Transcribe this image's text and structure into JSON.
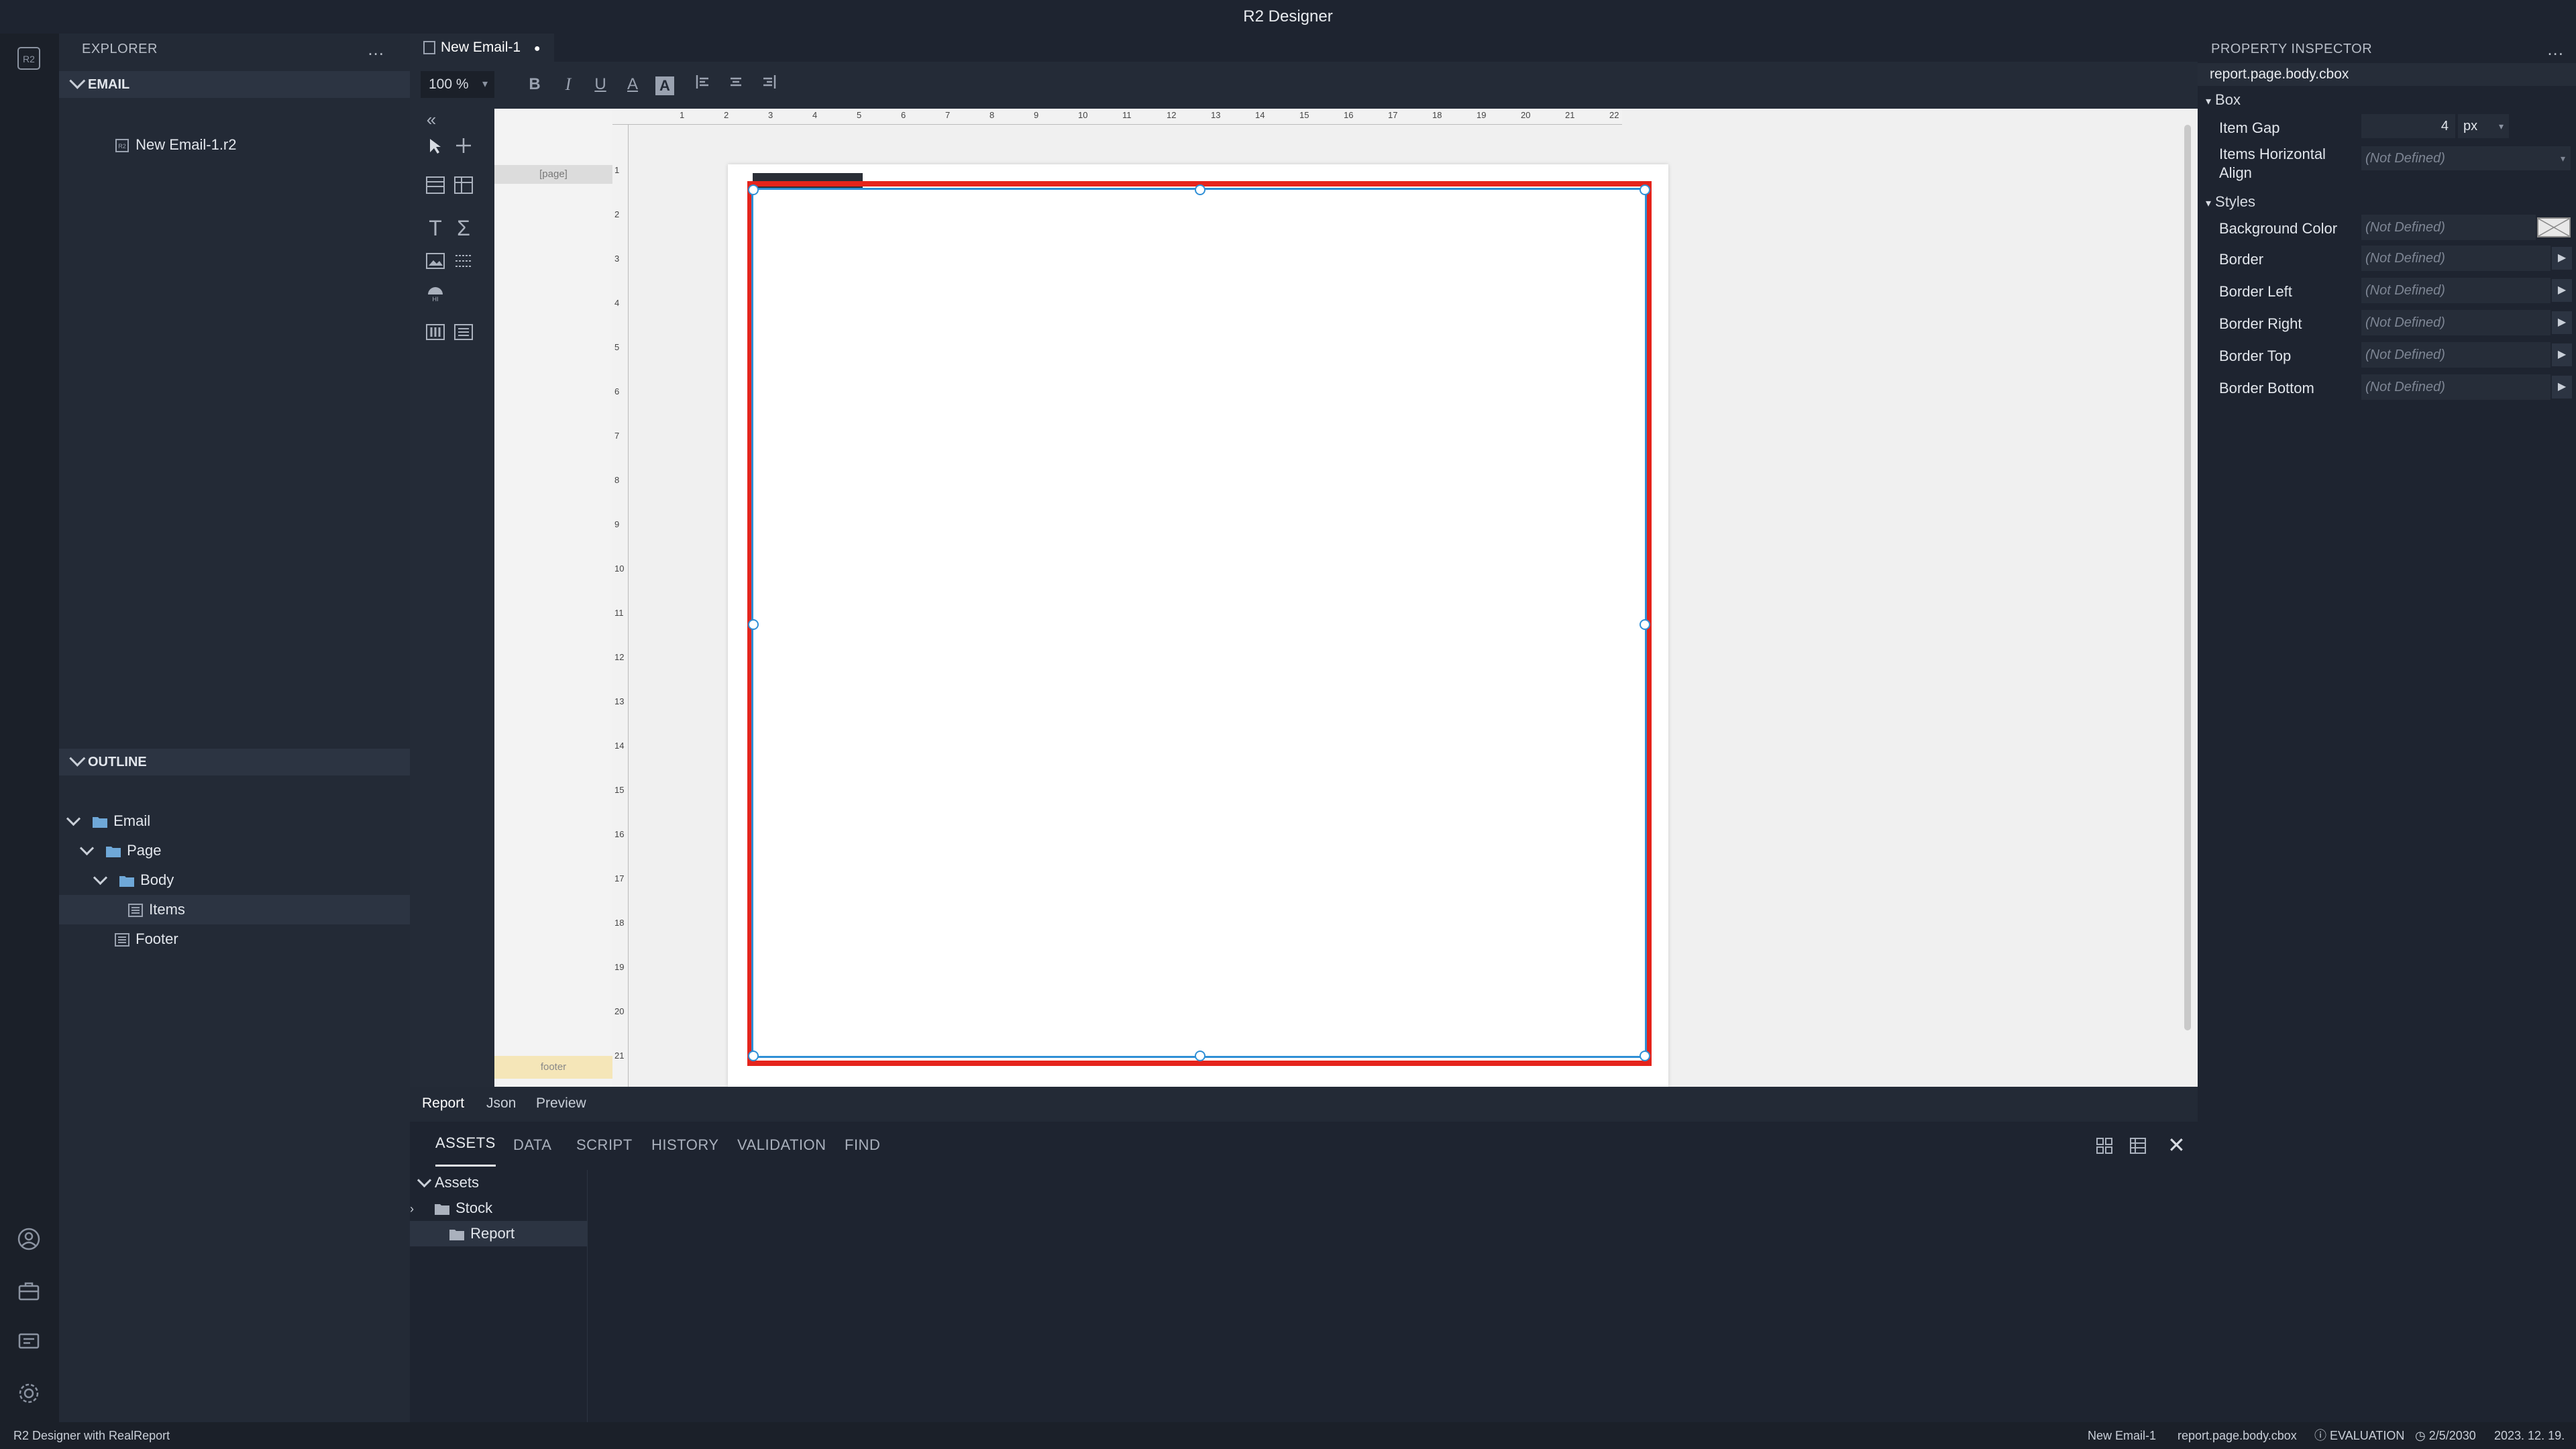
{
  "app": {
    "title": "R2 Designer"
  },
  "explorer": {
    "title": "EXPLORER",
    "menu": "...",
    "section": "EMAIL",
    "files": [
      {
        "label": "New Email-1.r2"
      }
    ]
  },
  "outline": {
    "title": "OUTLINE",
    "items": [
      {
        "label": "Email"
      },
      {
        "label": "Page"
      },
      {
        "label": "Body"
      },
      {
        "label": "Items"
      },
      {
        "label": "Footer"
      }
    ]
  },
  "editor": {
    "tab": {
      "label": "New Email-1",
      "modified": "●"
    },
    "zoom": "100 %",
    "bands": {
      "page": "[page]",
      "footer": "footer"
    },
    "ruler_h": [
      "1",
      "2",
      "3",
      "4",
      "5",
      "6",
      "7",
      "8",
      "9",
      "10",
      "11",
      "12",
      "13",
      "14",
      "15",
      "16",
      "17",
      "18",
      "19",
      "20",
      "21",
      "22"
    ],
    "ruler_v": [
      "1",
      "2",
      "3",
      "4",
      "5",
      "6",
      "7",
      "8",
      "9",
      "10",
      "11",
      "12",
      "13",
      "14",
      "15",
      "16",
      "17",
      "18",
      "19",
      "20",
      "21"
    ],
    "bottom_tabs": [
      "Report",
      "Json",
      "Preview"
    ]
  },
  "panel": {
    "tabs": [
      "ASSETS",
      "DATA",
      "SCRIPT",
      "HISTORY",
      "VALIDATION",
      "FIND"
    ],
    "tree": [
      {
        "label": "Assets"
      },
      {
        "label": "Stock"
      },
      {
        "label": "Report"
      }
    ]
  },
  "inspector": {
    "title": "PROPERTY INSPECTOR",
    "menu": "...",
    "path": "report.page.body.cbox",
    "box_section": "Box",
    "item_gap": {
      "label": "Item Gap",
      "value": "4",
      "unit": "px"
    },
    "items_halign": {
      "label": "Items Horizontal Align",
      "value": "(Not Defined)"
    },
    "styles_section": "Styles",
    "styles": [
      {
        "label": "Background Color",
        "value": "(Not Defined)"
      },
      {
        "label": "Border",
        "value": "(Not Defined)"
      },
      {
        "label": "Border Left",
        "value": "(Not Defined)"
      },
      {
        "label": "Border Right",
        "value": "(Not Defined)"
      },
      {
        "label": "Border Top",
        "value": "(Not Defined)"
      },
      {
        "label": "Border Bottom",
        "value": "(Not Defined)"
      }
    ]
  },
  "status": {
    "left": "R2 Designer with RealReport",
    "file": "New Email-1",
    "path": "report.page.body.cbox",
    "license": "EVALUATION",
    "expiry": "2/5/2030",
    "date": "2023. 12. 19."
  },
  "colors": {
    "selection_red": "#e5241c",
    "selection_blue": "#2f8fd6",
    "footer_band": "#f5e6b8"
  }
}
